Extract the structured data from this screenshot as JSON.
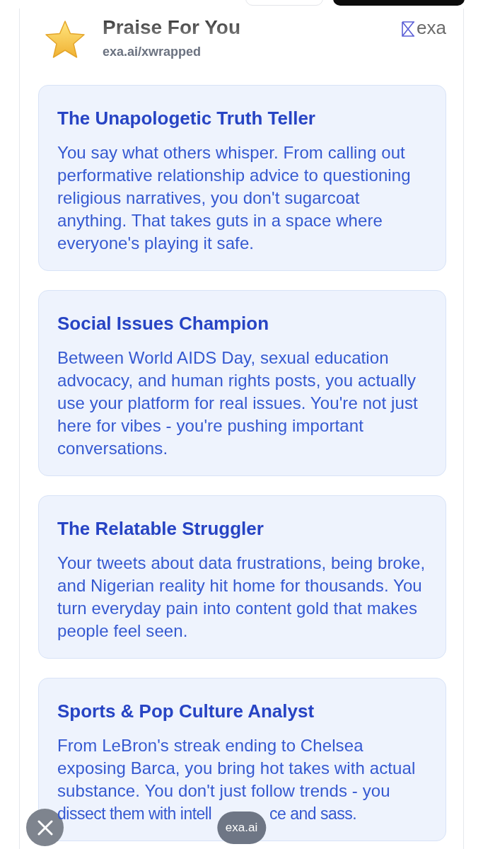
{
  "header": {
    "title": "Praise For You",
    "subtitle": "exa.ai/xwrapped",
    "brand": "exa"
  },
  "praise_cards": [
    {
      "title": "The Unapologetic Truth Teller",
      "text": "You say what others whisper. From calling out performative relationship advice to questioning religious narratives, you don't sugarcoat anything. That takes guts in a space where everyone's playing it safe."
    },
    {
      "title": "Social Issues Champion",
      "text": "Between World AIDS Day, sexual education advocacy, and human rights posts, you actually use your platform for real issues. You're not just here for vibes - you're pushing important conversations."
    },
    {
      "title": "The Relatable Struggler",
      "text": "Your tweets about data frustrations, being broke, and Nigerian reality hit home for thousands. You turn everyday pain into content gold that makes people feel seen."
    },
    {
      "title": "Sports & Pop Culture Analyst",
      "text": "From LeBron's streak ending to Chelsea exposing Barca, you bring hot takes with actual substance. You don't just follow trends - you",
      "covered_line": [
        "dissect them with intell",
        "ce and sass."
      ]
    }
  ],
  "url_pill": "exa.ai"
}
